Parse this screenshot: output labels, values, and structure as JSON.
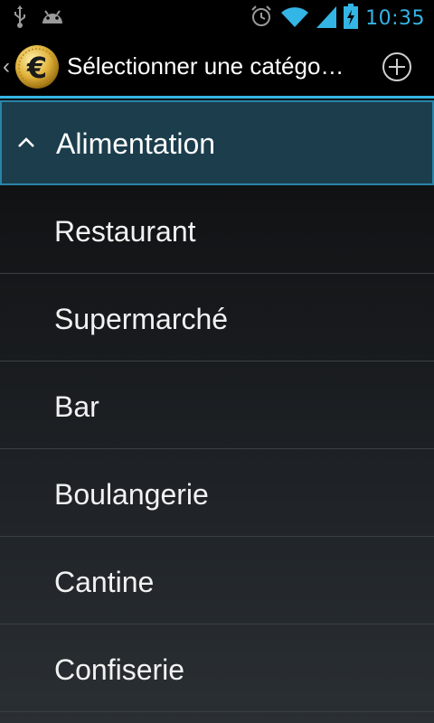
{
  "status_bar": {
    "time": "10:35",
    "icons": [
      "usb-icon",
      "android-debug-icon",
      "alarm-icon",
      "wifi-icon",
      "signal-icon",
      "battery-charging-icon"
    ],
    "accent_color": "#33b5e5"
  },
  "action_bar": {
    "title": "Sélectionner une catégo…",
    "up_icon": "chevron-left-icon",
    "logo_icon": "euro-coin-icon",
    "add_icon": "add-circle-icon"
  },
  "list": {
    "group": {
      "label": "Alimentation",
      "expanded": true,
      "color": "#1b3d4c"
    },
    "items": [
      {
        "label": "Restaurant"
      },
      {
        "label": "Supermarché"
      },
      {
        "label": "Bar"
      },
      {
        "label": "Boulangerie"
      },
      {
        "label": "Cantine"
      },
      {
        "label": "Confiserie"
      }
    ]
  }
}
